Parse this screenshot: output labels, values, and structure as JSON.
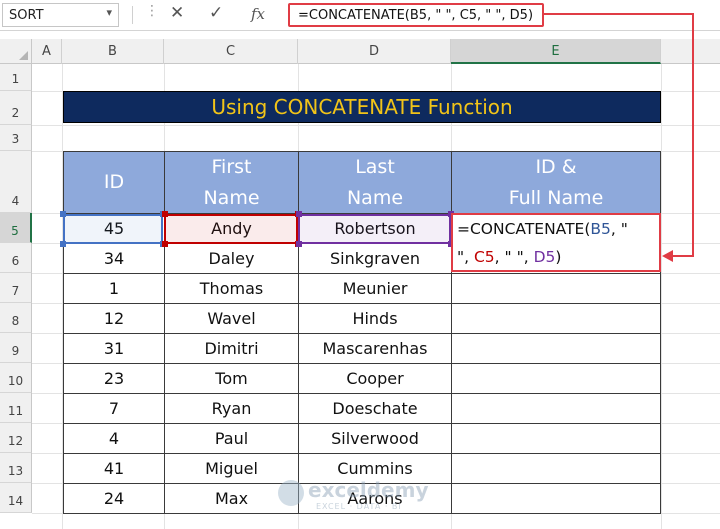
{
  "formula_bar": {
    "name_box": "SORT",
    "cancel_icon": "✕",
    "enter_icon": "✓",
    "fx_label": "fx",
    "formula": "=CONCATENATE(B5, \" \", C5, \" \", D5)"
  },
  "columns": [
    "A",
    "B",
    "C",
    "D",
    "E"
  ],
  "rows": [
    "1",
    "2",
    "3",
    "4",
    "5",
    "6",
    "7",
    "8",
    "9",
    "10",
    "11",
    "12",
    "13",
    "14"
  ],
  "title": "Using CONCATENATE Function",
  "table": {
    "headers": [
      {
        "lines": [
          "ID"
        ]
      },
      {
        "lines": [
          "First",
          "Name"
        ]
      },
      {
        "lines": [
          "Last",
          "Name"
        ]
      },
      {
        "lines": [
          "ID &",
          "Full Name"
        ]
      }
    ],
    "rows": [
      {
        "id": "45",
        "first": "Andy",
        "last": "Robertson"
      },
      {
        "id": "34",
        "first": "Daley",
        "last": "Sinkgraven"
      },
      {
        "id": "1",
        "first": "Thomas",
        "last": "Meunier"
      },
      {
        "id": "12",
        "first": "Wavel",
        "last": "Hinds"
      },
      {
        "id": "31",
        "first": "Dimitri",
        "last": "Mascarenhas"
      },
      {
        "id": "23",
        "first": "Tom",
        "last": "Cooper"
      },
      {
        "id": "7",
        "first": "Ryan",
        "last": "Doeschate"
      },
      {
        "id": "4",
        "first": "Paul",
        "last": "Silverwood"
      },
      {
        "id": "41",
        "first": "Miguel",
        "last": "Cummins"
      },
      {
        "id": "24",
        "first": "Max",
        "last": "Aarons"
      }
    ]
  },
  "edit_cell": {
    "line1_prefix": "=CONCATENATE(",
    "ref1": "B5",
    "line1_suffix": ", \"",
    "line2_prefix": "\", ",
    "ref2": "C5",
    "line2_mid": ", \" \", ",
    "ref3": "D5",
    "line2_suffix": ")"
  },
  "watermark": {
    "brand": "exceldemy",
    "tagline": "EXCEL · DATA · BI"
  },
  "colors": {
    "title_bg": "#0e2a5e",
    "title_fg": "#f2c418",
    "header_bg": "#8ea9db",
    "accent_red": "#e03c45",
    "ref_blue": "#2f5597",
    "ref_red": "#c00000",
    "ref_purple": "#7030a0"
  }
}
